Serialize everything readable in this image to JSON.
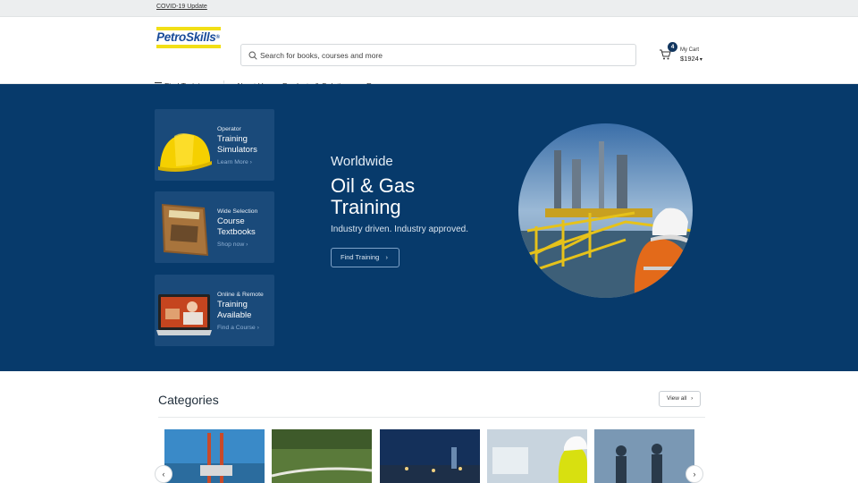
{
  "topbar": {
    "covid_link": "COVID-19 Update"
  },
  "header": {
    "logo_text": "PetroSkills",
    "logo_mark": "®",
    "search_placeholder": "Search for books, courses and more",
    "cart": {
      "count": "4",
      "label": "My Cart",
      "total": "$1924"
    }
  },
  "nav": {
    "find_training": "Find Training",
    "items": [
      "About Us",
      "Products & Solutions",
      "Resources"
    ]
  },
  "hero": {
    "cards": [
      {
        "line1": "Operator",
        "line2": "Training",
        "line3": "Simulators",
        "link": "Learn More"
      },
      {
        "line1": "Wide Selection",
        "line2": "Course",
        "line3": "Textbooks",
        "link": "Shop now"
      },
      {
        "line1": "Online & Remote",
        "line2": "Training",
        "line3": "Available",
        "link": "Find a Course"
      }
    ],
    "subtitle": "Worldwide",
    "title": "Oil & Gas Training",
    "tagline": "Industry driven. Industry approved.",
    "button": "Find Training"
  },
  "categories": {
    "title": "Categories",
    "view_all": "View all"
  },
  "colors": {
    "brand_navy": "#073a6b",
    "logo_blue": "#174a99",
    "logo_yellow": "#f2df16"
  }
}
